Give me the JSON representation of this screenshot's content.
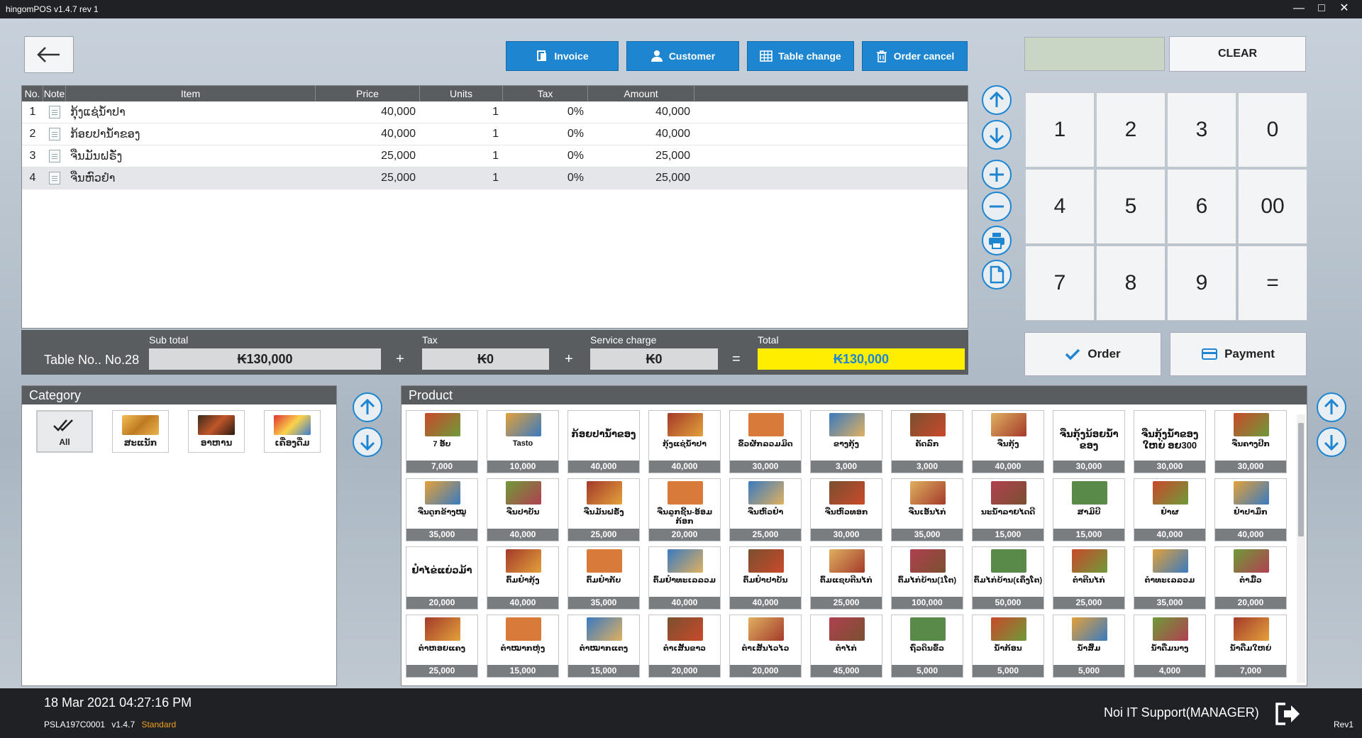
{
  "window": {
    "title": "hingomPOS v1.4.7 rev 1"
  },
  "toolbar": {
    "invoice": "Invoice",
    "customer": "Customer",
    "table_change": "Table change",
    "order_cancel": "Order cancel"
  },
  "order": {
    "headers": {
      "no": "No.",
      "note": "Note",
      "item": "Item",
      "price": "Price",
      "units": "Units",
      "tax": "Tax",
      "amount": "Amount"
    },
    "rows": [
      {
        "no": "1",
        "item": "ກຸ້ງແຊ່ນ້ຳປາ",
        "price": "40,000",
        "units": "1",
        "tax": "0%",
        "amount": "40,000"
      },
      {
        "no": "2",
        "item": "ກ້ອຍປານ້ຳຂອງ",
        "price": "40,000",
        "units": "1",
        "tax": "0%",
        "amount": "40,000"
      },
      {
        "no": "3",
        "item": "ຈືນມັນຝຣັ່ງ",
        "price": "25,000",
        "units": "1",
        "tax": "0%",
        "amount": "25,000"
      },
      {
        "no": "4",
        "item": "ຈືນຫົວຢຳ",
        "price": "25,000",
        "units": "1",
        "tax": "0%",
        "amount": "25,000"
      }
    ]
  },
  "totals": {
    "table_no": "Table No.. No.28",
    "subtotal_label": "Sub total",
    "subtotal": "₭130,000",
    "tax_label": "Tax",
    "tax": "₭0",
    "service_label": "Service charge",
    "service": "₭0",
    "total_label": "Total",
    "total": "₭130,000",
    "plus": "+",
    "equals": "="
  },
  "keypad": {
    "clear": "CLEAR",
    "keys": [
      "1",
      "2",
      "3",
      "0",
      "4",
      "5",
      "6",
      "00",
      "7",
      "8",
      "9",
      "="
    ],
    "order": "Order",
    "payment": "Payment"
  },
  "category": {
    "title": "Category",
    "items": [
      {
        "label": "All"
      },
      {
        "label": "ສະແນັກ"
      },
      {
        "label": "ອາຫານ"
      },
      {
        "label": "ເຄື່ອງດື່ມ"
      }
    ]
  },
  "product": {
    "title": "Product",
    "items": [
      {
        "name": "7 ອັບ",
        "price": "7,000"
      },
      {
        "name": "Tasto",
        "price": "10,000"
      },
      {
        "name": "ກ້ອຍປານ້ຳຂອງ",
        "price": "40,000"
      },
      {
        "name": "ກຸ້ງແຊ່ນ້ຳປາ",
        "price": "40,000"
      },
      {
        "name": "ຂົ້ວຜັກລວມມິດ",
        "price": "30,000"
      },
      {
        "name": "ຂາງກຸ້ງ",
        "price": "3,000"
      },
      {
        "name": "ຄັດລົກ",
        "price": "3,000"
      },
      {
        "name": "ຈືນກຸ້ງ",
        "price": "40,000"
      },
      {
        "name": "ຈືນກຸ້ງນ້ອຍນ້ຳຂອງ",
        "price": "30,000"
      },
      {
        "name": "ຈືນກຸ້ງນ້ຳຂອງໃຫຍ່ ອຍ300",
        "price": "30,000"
      },
      {
        "name": "ຈືນຄາງປີກ",
        "price": "30,000"
      },
      {
        "name": "ຈືນດູກຂ້າງໝູ",
        "price": "35,000"
      },
      {
        "name": "ຈືນປາບັນ",
        "price": "40,000"
      },
      {
        "name": "ຈືນມັນຝຣັ່ງ",
        "price": "25,000"
      },
      {
        "name": "ຈືນລູກຊີ້ນ-ອ້ອມກ້ອກ",
        "price": "20,000"
      },
      {
        "name": "ຈືນຫົວຢຳ",
        "price": "25,000"
      },
      {
        "name": "ຈືນຫົວທອກ",
        "price": "30,000"
      },
      {
        "name": "ຈືນເອັນໄກ່",
        "price": "35,000"
      },
      {
        "name": "ນະນ້ຳລາຍໄດດີ",
        "price": "15,000"
      },
      {
        "name": "ສາມິບີ",
        "price": "15,000"
      },
      {
        "name": "ຢຳຜ",
        "price": "40,000"
      },
      {
        "name": "ຢຳປາມຶກ",
        "price": "40,000"
      },
      {
        "name": "ຢຳໄຂ່ແຍ່ວມ້າ",
        "price": "20,000"
      },
      {
        "name": "ຕົ້ມຢຳກຸ້ງ",
        "price": "40,000"
      },
      {
        "name": "ຕົ້ມຢຳກັບ",
        "price": "35,000"
      },
      {
        "name": "ຕົ້ມຢຳທະເລລວມ",
        "price": "40,000"
      },
      {
        "name": "ຕົ້ມຢຳປາບັນ",
        "price": "40,000"
      },
      {
        "name": "ຕົ້ມແຊບຕີນໄກ່",
        "price": "25,000"
      },
      {
        "name": "ຕົ້ມໄກ່ບ້ານ(1ໂຕ)",
        "price": "100,000"
      },
      {
        "name": "ຕົ້ມໄກ່ບ້ານ(ເຄິ່ງໂຕ)",
        "price": "50,000"
      },
      {
        "name": "ຕຳຕີນໄກ່",
        "price": "25,000"
      },
      {
        "name": "ຕຳທະເລລວມ",
        "price": "35,000"
      },
      {
        "name": "ຕຳມື້ວ",
        "price": "20,000"
      },
      {
        "name": "ຕຳຫອຍແຄງ",
        "price": "25,000"
      },
      {
        "name": "ຕຳໝາກຫຸ່ງ",
        "price": "15,000"
      },
      {
        "name": "ຕຳໝາກແຕງ",
        "price": "15,000"
      },
      {
        "name": "ຕຳເສັ້ນຂາວ",
        "price": "20,000"
      },
      {
        "name": "ຕຳເສັ້ນໄວໄວ",
        "price": "20,000"
      },
      {
        "name": "ຕຳໄກ່",
        "price": "45,000"
      },
      {
        "name": "ຖົ່ວດິນຂົ້ວ",
        "price": "5,000"
      },
      {
        "name": "ນ້ຳກ້ອນ",
        "price": "5,000"
      },
      {
        "name": "ນ້ຳສົ້ມ",
        "price": "5,000"
      },
      {
        "name": "ນ້ຳດື່ມນາງ",
        "price": "4,000"
      },
      {
        "name": "ນ້ຳດື່ມໃຫຍ່",
        "price": "7,000"
      }
    ]
  },
  "footer": {
    "datetime": "18 Mar 2021 04:27:16 PM",
    "device": "PSLA197C0001",
    "version": "v1.4.7",
    "edition": "Standard",
    "user": "Noi IT Support(MANAGER)",
    "rev": "Rev1"
  }
}
